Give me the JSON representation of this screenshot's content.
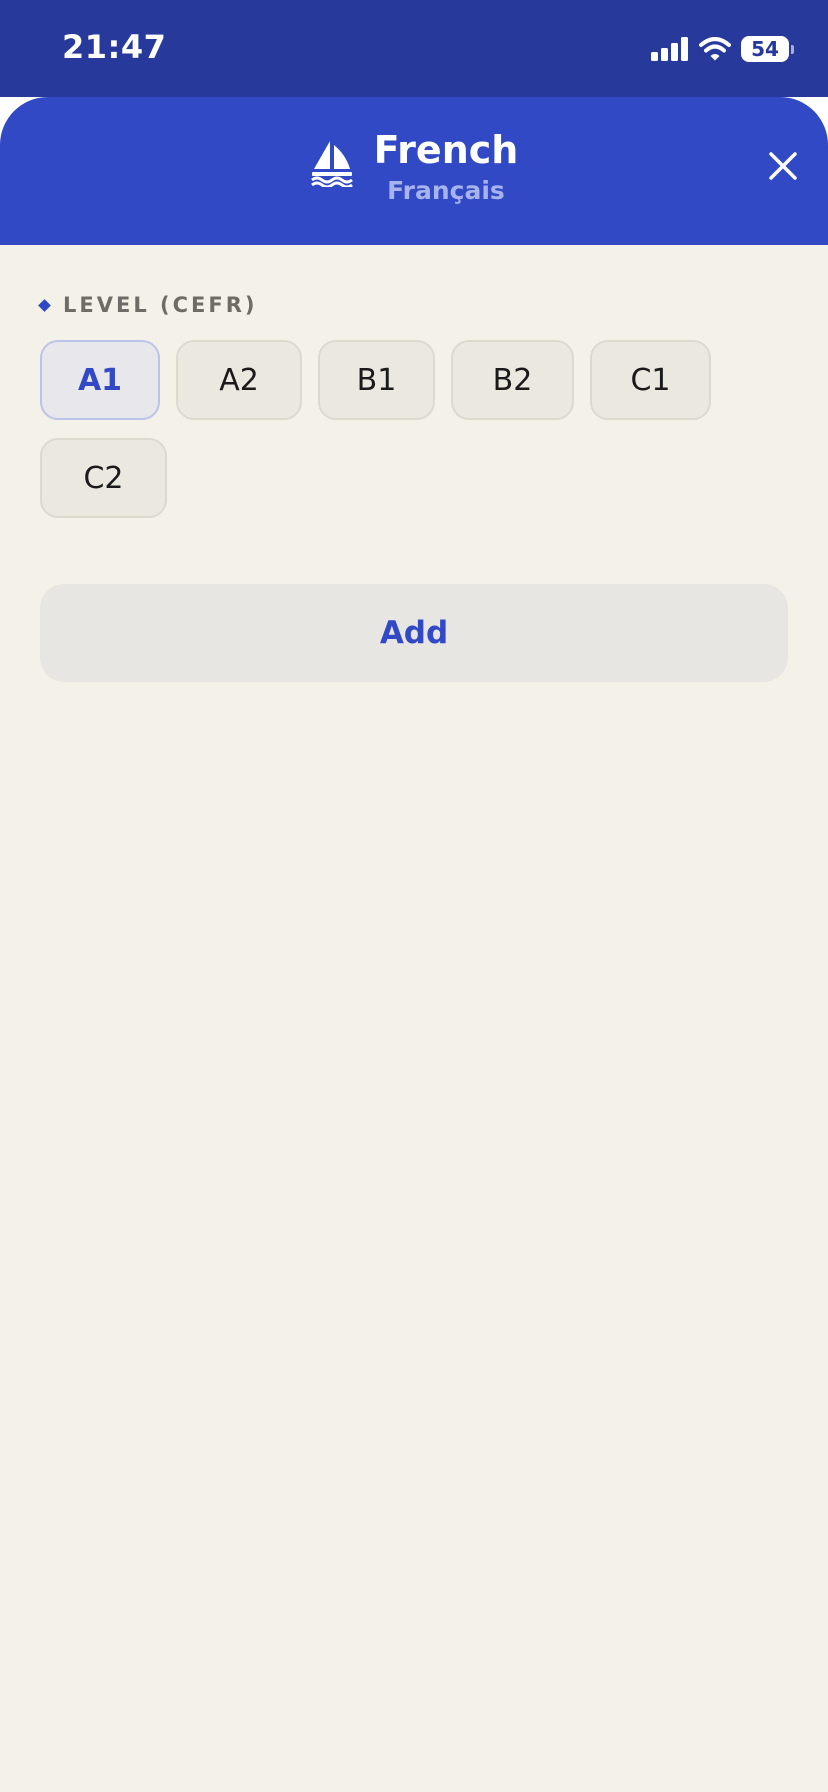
{
  "status_bar": {
    "time": "21:47",
    "battery": "54",
    "battery_percent": 54,
    "icons": [
      "signal-icon",
      "wifi-icon",
      "battery-icon"
    ]
  },
  "header": {
    "title": "French",
    "subtitle": "Français",
    "icon": "sailboat-icon",
    "close_icon": "close-icon"
  },
  "level_section": {
    "label": "LEVEL (CEFR)",
    "options": [
      "A1",
      "A2",
      "B1",
      "B2",
      "C1",
      "C2"
    ],
    "selected": "A1"
  },
  "actions": {
    "add_label": "Add"
  },
  "colors": {
    "status_bar": "#27399b",
    "header": "#3249c5",
    "background": "#f4f2e8",
    "accent": "#3249c5"
  }
}
